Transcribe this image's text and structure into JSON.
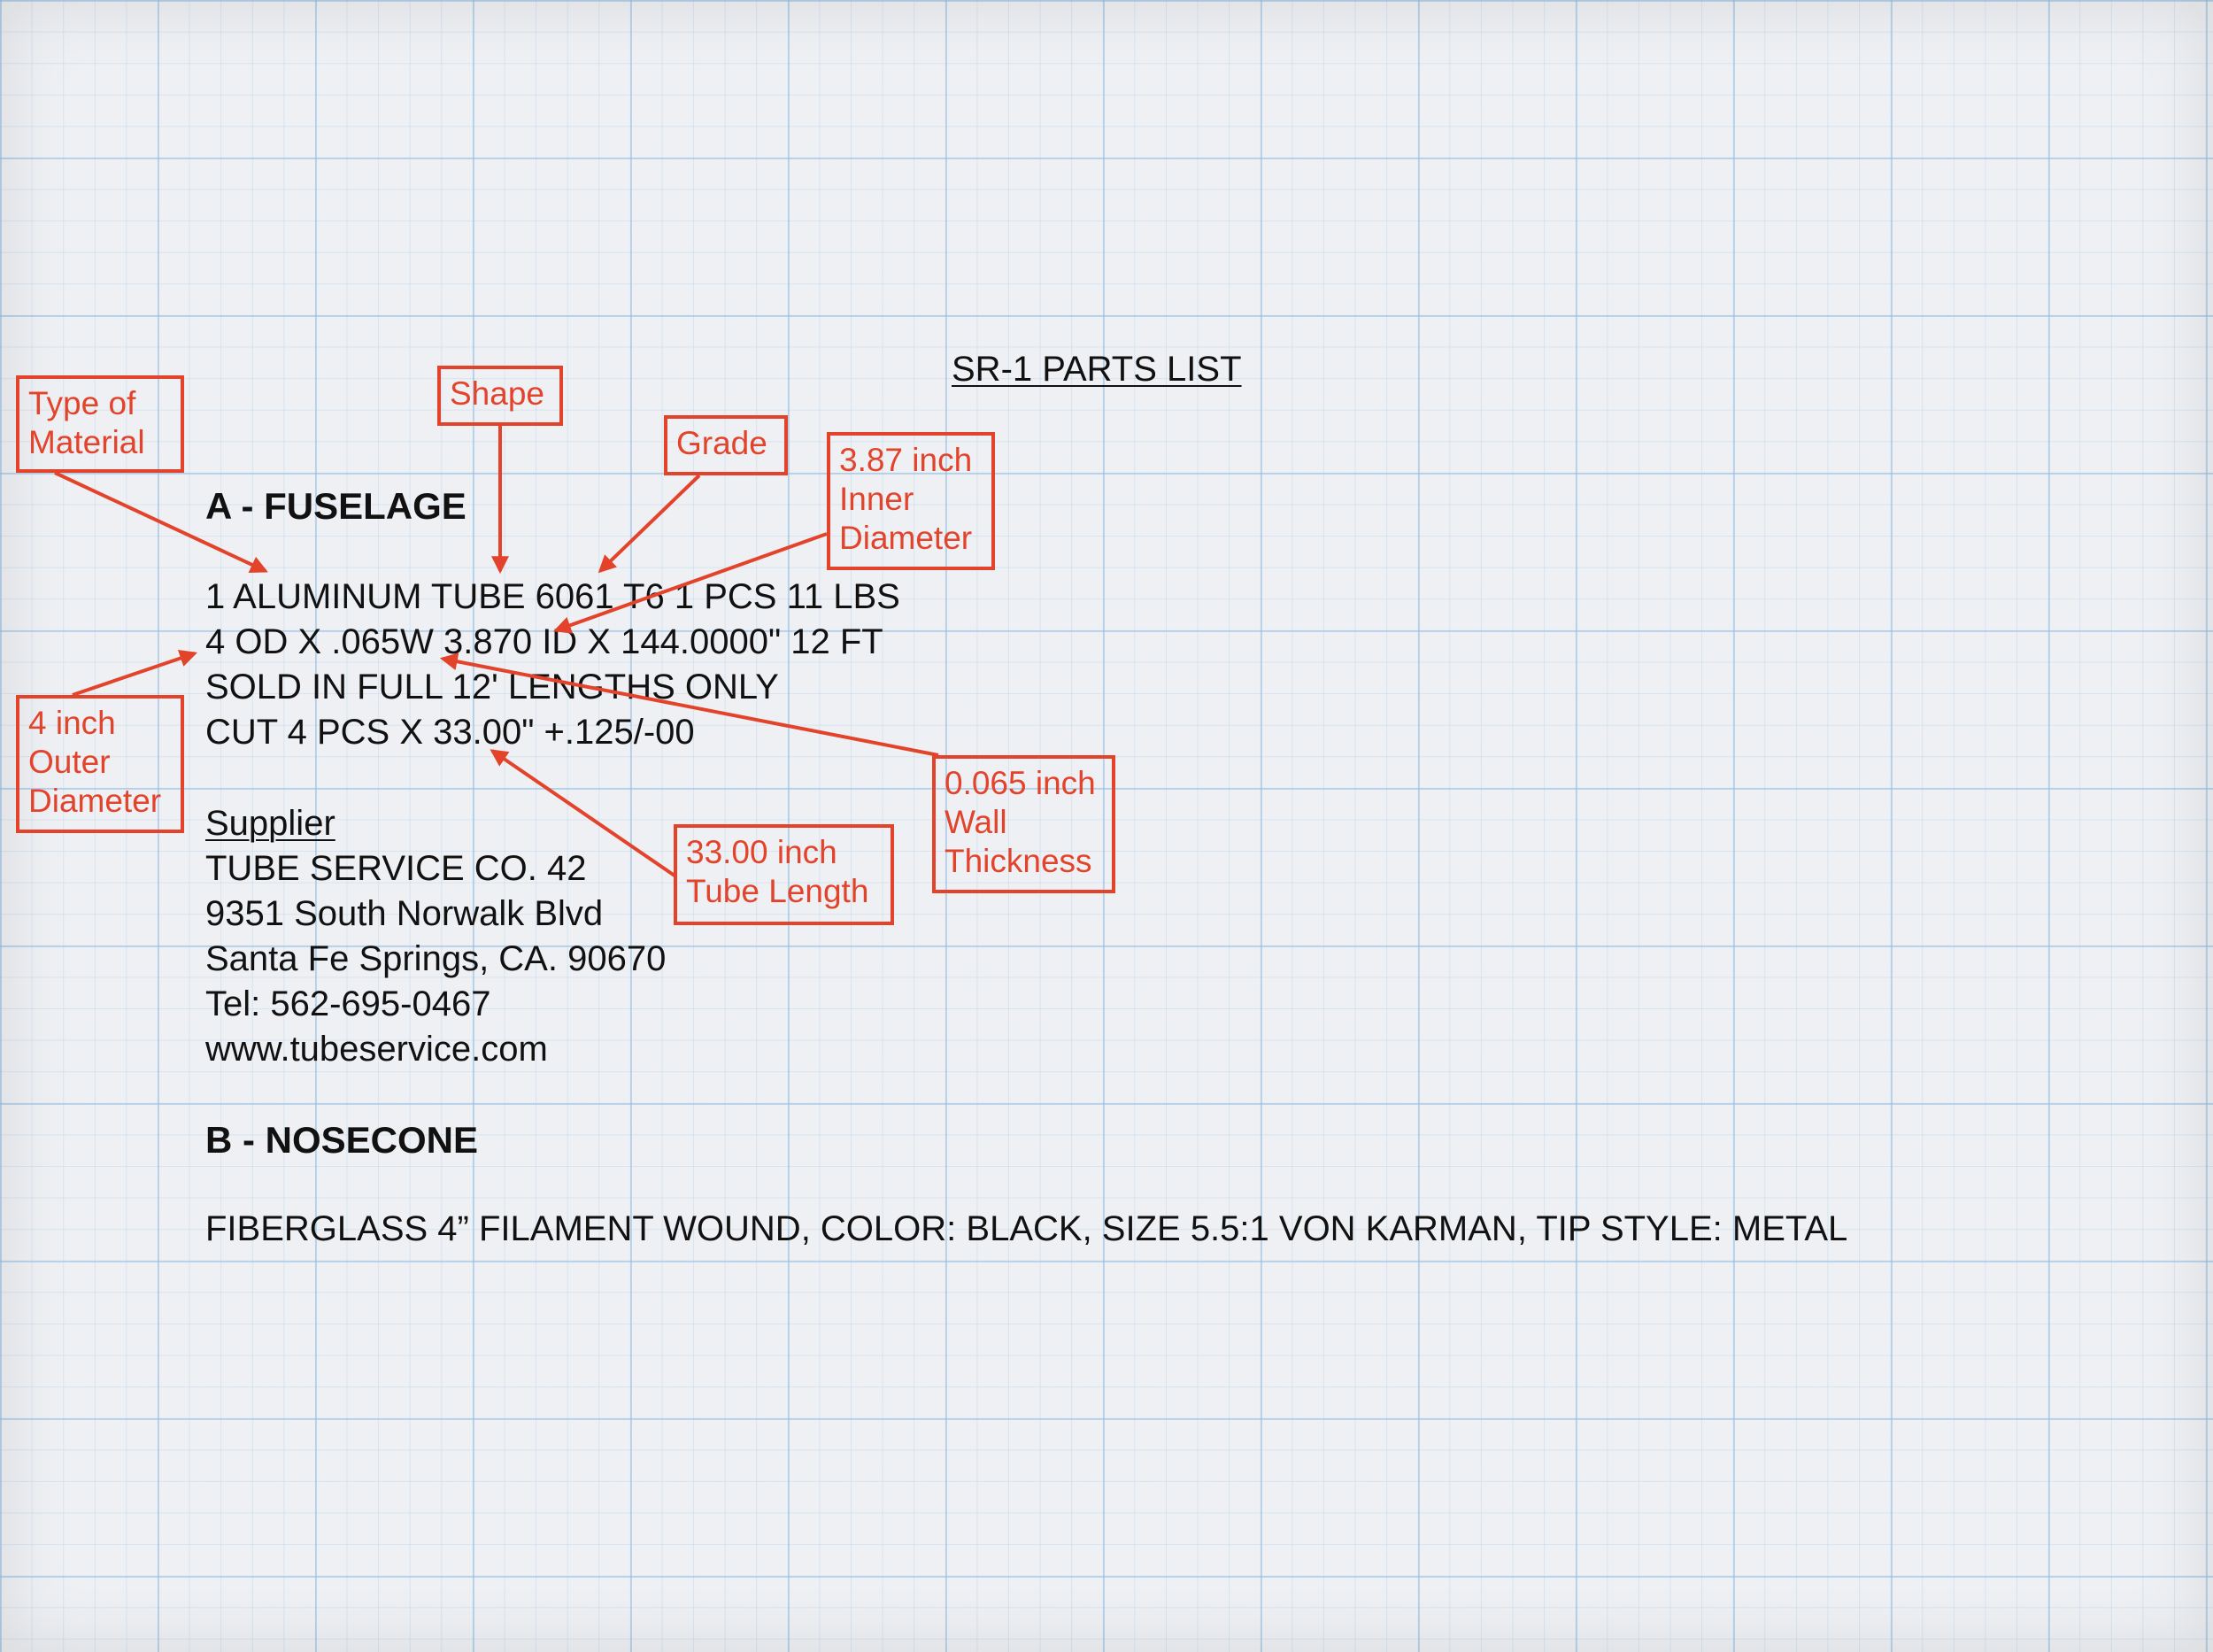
{
  "title": "SR-1 PARTS LIST",
  "section_a": {
    "heading": "A - FUSELAGE",
    "lines": [
      "1 ALUMINUM TUBE 6061 T6 1 PCS 11 LBS",
      "4 OD X .065W 3.870 ID X 144.0000\" 12 FT",
      "SOLD IN FULL 12' LENGTHS ONLY",
      "CUT 4 PCS X 33.00\" +.125/-00"
    ],
    "supplier": {
      "label": "Supplier",
      "name": "TUBE SERVICE CO. 42",
      "street": "9351 South Norwalk Blvd",
      "city": "Santa Fe Springs, CA. 90670",
      "tel": "Tel: 562-695-0467",
      "web": "www.tubeservice.com"
    }
  },
  "section_b": {
    "heading": "B - NOSECONE",
    "line": "FIBERGLASS 4” FILAMENT WOUND, COLOR: BLACK, SIZE 5.5:1 VON KARMAN, TIP STYLE: METAL"
  },
  "callouts": {
    "type_of_material": [
      "Type of",
      "Material"
    ],
    "shape": [
      "Shape"
    ],
    "grade": [
      "Grade"
    ],
    "inner_diameter": [
      "3.87 inch",
      "Inner",
      "Diameter"
    ],
    "outer_diameter": [
      "4 inch",
      "Outer",
      "Diameter"
    ],
    "wall_thickness": [
      "0.065 inch",
      "Wall",
      "Thickness"
    ],
    "tube_length": [
      "33.00 inch",
      "Tube Length"
    ]
  },
  "colors": {
    "annotation": "#e4432b",
    "text": "#111111",
    "grid": "#96bee1",
    "background": "#eef0f3"
  }
}
